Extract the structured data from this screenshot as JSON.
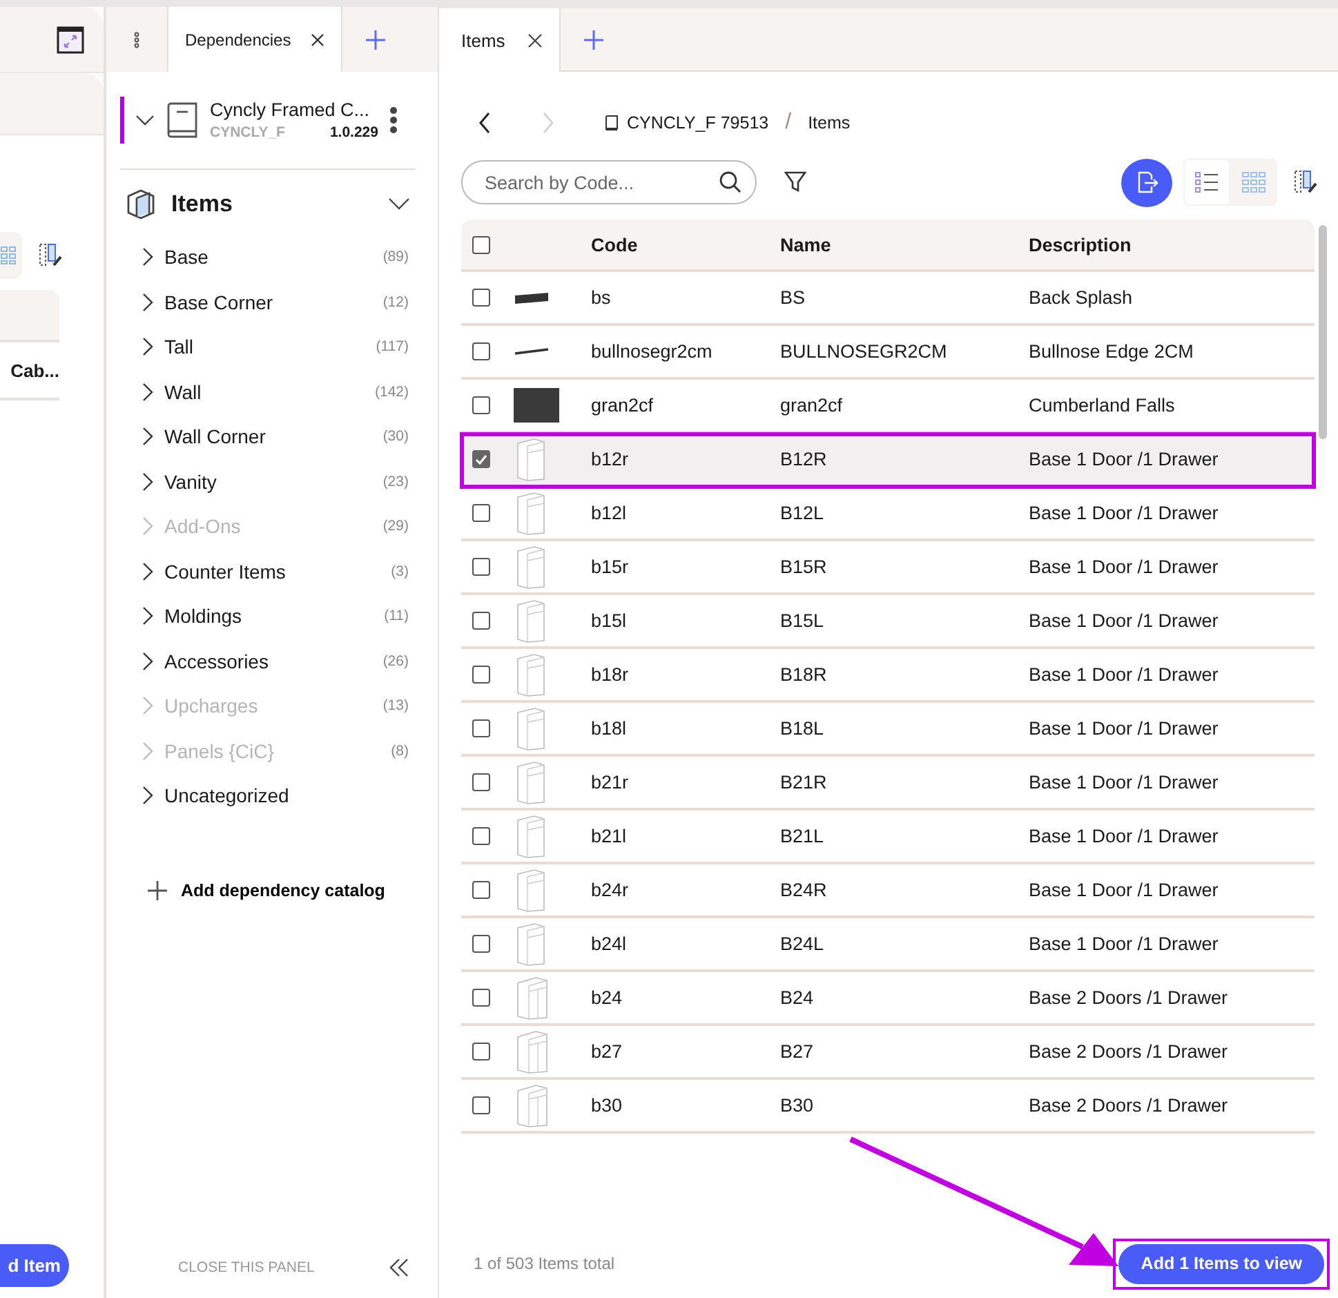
{
  "left_panel": {
    "card_title": "Cab...",
    "button": "d Item"
  },
  "tabs": [
    {
      "label": "Dependencies",
      "selected": true
    }
  ],
  "catalog": {
    "name": "Cyncly Framed C...",
    "code": "CYNCLY_F",
    "version": "1.0.229",
    "selected": true,
    "expanded": true
  },
  "items_section": {
    "title": "Items",
    "expanded": true
  },
  "categories": [
    {
      "label": "Base",
      "count": "(89)",
      "disabled": false
    },
    {
      "label": "Base Corner",
      "count": "(12)",
      "disabled": false
    },
    {
      "label": "Tall",
      "count": "(117)",
      "disabled": false
    },
    {
      "label": "Wall",
      "count": "(142)",
      "disabled": false
    },
    {
      "label": "Wall Corner",
      "count": "(30)",
      "disabled": false
    },
    {
      "label": "Vanity",
      "count": "(23)",
      "disabled": false
    },
    {
      "label": "Add-Ons",
      "count": "(29)",
      "disabled": true
    },
    {
      "label": "Counter Items",
      "count": "(3)",
      "disabled": false
    },
    {
      "label": "Moldings",
      "count": "(11)",
      "disabled": false
    },
    {
      "label": "Accessories",
      "count": "(26)",
      "disabled": false
    },
    {
      "label": "Upcharges",
      "count": "(13)",
      "disabled": true
    },
    {
      "label": "Panels {CiC}",
      "count": "(8)",
      "disabled": true
    },
    {
      "label": "Uncategorized",
      "disabled": false
    }
  ],
  "add_dependency": "Add dependency catalog",
  "close_panel": "CLOSE THIS PANEL",
  "content_tabs": [
    {
      "label": "Items",
      "selected": true
    }
  ],
  "breadcrumb": [
    "CYNCLY_F 79513",
    "Items"
  ],
  "breadcrumb_separator": "/",
  "search": {
    "placeholder": "Search by Code..."
  },
  "view_buttons": [
    {
      "kind": "list",
      "selected": true
    },
    {
      "kind": "grid",
      "selected": false
    }
  ],
  "table": {
    "columns": [
      "Code",
      "Name",
      "Description"
    ],
    "all_checked": false,
    "rows": [
      {
        "code": "bs",
        "name": "BS",
        "description": "Back Splash",
        "checked": false,
        "selected": false,
        "kind": "bar"
      },
      {
        "code": "bullnosegr2cm",
        "name": "BULLNOSEGR2CM",
        "description": "Bullnose Edge 2CM",
        "checked": false,
        "selected": false,
        "kind": "line"
      },
      {
        "code": "gran2cf",
        "name": "gran2cf",
        "description": "Cumberland Falls",
        "checked": false,
        "selected": false,
        "kind": "swatch"
      },
      {
        "code": "b12r",
        "name": "B12R",
        "description": "Base 1 Door /1 Drawer",
        "checked": true,
        "selected": true,
        "kind": "cabinet"
      },
      {
        "code": "b12l",
        "name": "B12L",
        "description": "Base 1 Door /1 Drawer",
        "checked": false,
        "selected": false,
        "kind": "cabinet"
      },
      {
        "code": "b15r",
        "name": "B15R",
        "description": "Base 1 Door /1 Drawer",
        "checked": false,
        "selected": false,
        "kind": "cabinet"
      },
      {
        "code": "b15l",
        "name": "B15L",
        "description": "Base 1 Door /1 Drawer",
        "checked": false,
        "selected": false,
        "kind": "cabinet"
      },
      {
        "code": "b18r",
        "name": "B18R",
        "description": "Base 1 Door /1 Drawer",
        "checked": false,
        "selected": false,
        "kind": "cabinet"
      },
      {
        "code": "b18l",
        "name": "B18L",
        "description": "Base 1 Door /1 Drawer",
        "checked": false,
        "selected": false,
        "kind": "cabinet"
      },
      {
        "code": "b21r",
        "name": "B21R",
        "description": "Base 1 Door /1 Drawer",
        "checked": false,
        "selected": false,
        "kind": "cabinet"
      },
      {
        "code": "b21l",
        "name": "B21L",
        "description": "Base 1 Door /1 Drawer",
        "checked": false,
        "selected": false,
        "kind": "cabinet"
      },
      {
        "code": "b24r",
        "name": "B24R",
        "description": "Base 1 Door /1 Drawer",
        "checked": false,
        "selected": false,
        "kind": "cabinet"
      },
      {
        "code": "b24l",
        "name": "B24L",
        "description": "Base 1 Door /1 Drawer",
        "checked": false,
        "selected": false,
        "kind": "cabinet"
      },
      {
        "code": "b24",
        "name": "B24",
        "description": "Base 2 Doors /1 Drawer",
        "checked": false,
        "selected": false,
        "kind": "cabinet2"
      },
      {
        "code": "b27",
        "name": "B27",
        "description": "Base 2 Doors /1 Drawer",
        "checked": false,
        "selected": false,
        "kind": "cabinet2"
      },
      {
        "code": "b30",
        "name": "B30",
        "description": "Base 2 Doors /1 Drawer",
        "checked": false,
        "selected": false,
        "kind": "cabinet2"
      }
    ]
  },
  "status": "1 of 503 Items total",
  "add_button": "Add 1 Items to view"
}
